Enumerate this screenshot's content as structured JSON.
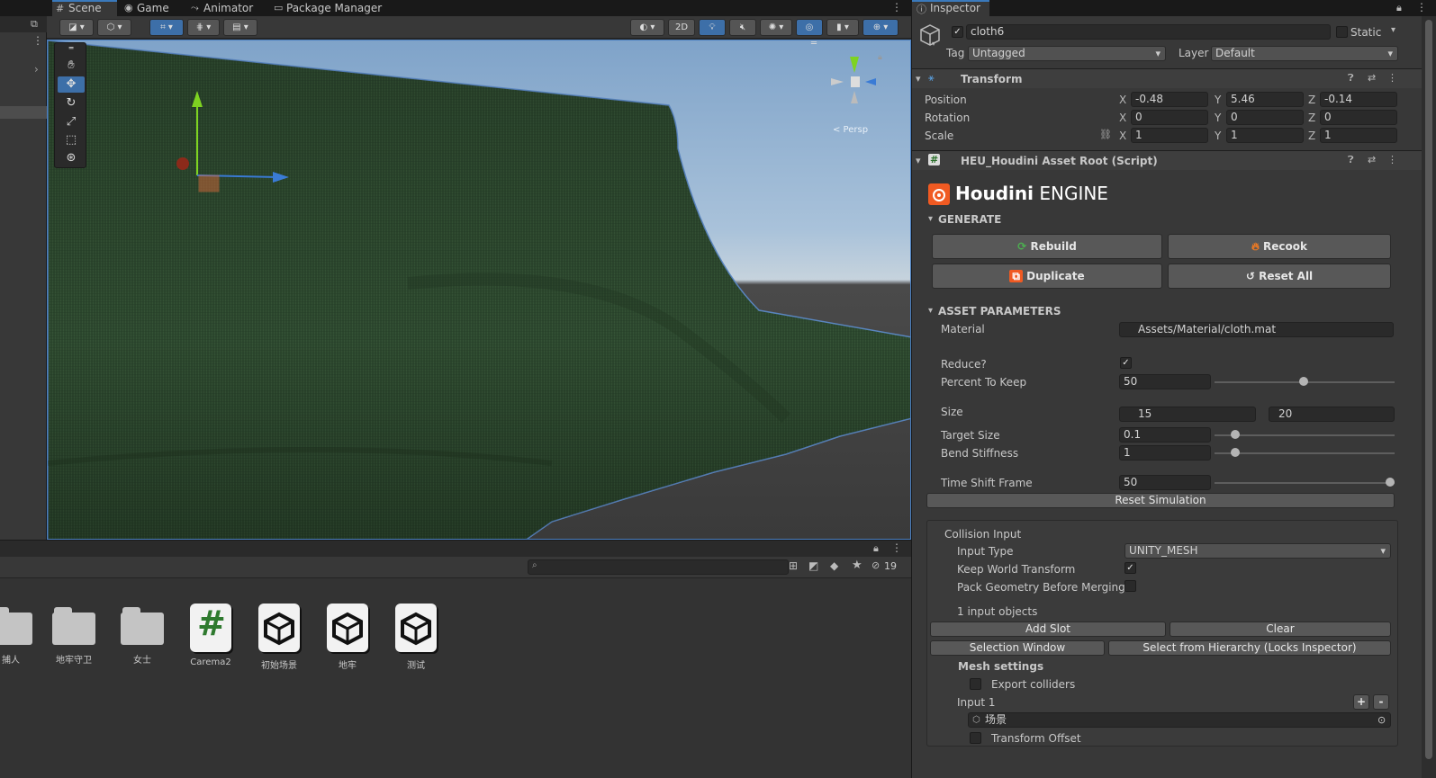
{
  "scene_tabs": {
    "scene": "Scene",
    "game": "Game",
    "animator": "Animator",
    "package_manager": "Package Manager"
  },
  "toolbar": {
    "mode_2d": "2D"
  },
  "gizmo": {
    "persp_label": "< Persp"
  },
  "project": {
    "hidden_count": "19",
    "assets": [
      {
        "label": "捕人",
        "kind": "folder"
      },
      {
        "label": "地牢守卫",
        "kind": "folder"
      },
      {
        "label": "女士",
        "kind": "folder"
      },
      {
        "label": "Carema2",
        "kind": "script",
        "glyph": "#"
      },
      {
        "label": "初始场景",
        "kind": "scene"
      },
      {
        "label": "地牢",
        "kind": "scene"
      },
      {
        "label": "测试",
        "kind": "scene"
      }
    ]
  },
  "inspector": {
    "tab": "Inspector",
    "object_name": "cloth6",
    "static_label": "Static",
    "tag_label": "Tag",
    "tag_value": "Untagged",
    "layer_label": "Layer",
    "layer_value": "Default",
    "transform": {
      "title": "Transform",
      "position_label": "Position",
      "rotation_label": "Rotation",
      "scale_label": "Scale",
      "axis_x": "X",
      "axis_y": "Y",
      "axis_z": "Z",
      "position": {
        "x": "-0.48",
        "y": "5.46",
        "z": "-0.14"
      },
      "rotation": {
        "x": "0",
        "y": "0",
        "z": "0"
      },
      "scale": {
        "x": "1",
        "y": "1",
        "z": "1"
      }
    },
    "heu": {
      "title": "HEU_Houdini Asset Root (Script)",
      "logo_bold": "Houdini",
      "logo_light": "ENGINE",
      "generate_label": "GENERATE",
      "rebuild": "Rebuild",
      "recook": "Recook",
      "duplicate": "Duplicate",
      "reset_all": "Reset All",
      "asset_params_label": "ASSET PARAMETERS",
      "material_label": "Material",
      "material_value": "Assets/Material/cloth.mat",
      "reduce_label": "Reduce?",
      "percent_label": "Percent To Keep",
      "percent_value": "50",
      "size_label": "Size",
      "size_w": "15",
      "size_h": "20",
      "target_size_label": "Target Size",
      "target_size_value": "0.1",
      "bend_label": "Bend Stiffness",
      "bend_value": "1",
      "time_shift_label": "Time Shift Frame",
      "time_shift_value": "50",
      "reset_sim": "Reset Simulation",
      "collision_label": "Collision Input",
      "input_type_label": "Input Type",
      "input_type_value": "UNITY_MESH",
      "keep_world_label": "Keep World Transform",
      "pack_geo_label": "Pack Geometry Before Merging",
      "input_objects": "1 input objects",
      "add_slot": "Add Slot",
      "clear": "Clear",
      "selection_window": "Selection Window",
      "select_hierarchy": "Select from Hierarchy (Locks Inspector)",
      "mesh_settings": "Mesh settings",
      "export_colliders": "Export colliders",
      "input1_label": "Input 1",
      "plus": "+",
      "minus": "-",
      "input1_value": "场景",
      "transform_offset": "Transform Offset"
    }
  },
  "colors": {
    "accent_blue": "#3d6fa8",
    "cloth_green": "#2f4a30",
    "houdini_orange": "#f05a22"
  }
}
